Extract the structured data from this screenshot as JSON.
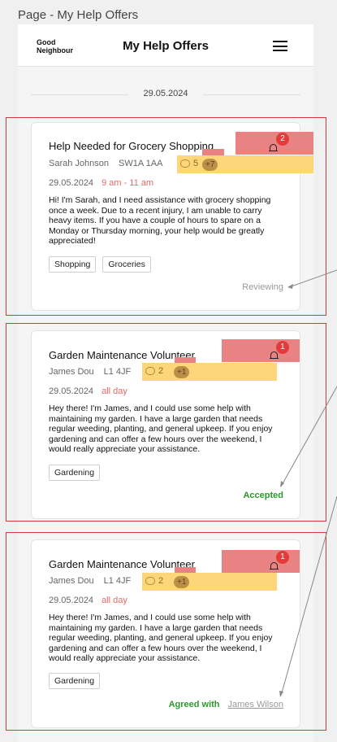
{
  "page_caption": "Page - My Help Offers",
  "topbar": {
    "logo_line1": "Good",
    "logo_line2": "Neighbour",
    "title": "My Help Offers"
  },
  "date_separator": "29.05.2024",
  "offers": [
    {
      "title": "Help Needed for Grocery Shopping",
      "name": "Sarah Johnson",
      "postcode": "SW1A 1AA",
      "comments": "5",
      "more": "+7",
      "notifications": "2",
      "date": "29.05.2024",
      "time": "9 am - 11 am",
      "description": "Hi! I'm Sarah, and I need assistance with grocery shopping once a week. Due to a recent injury, I am unable to carry heavy items. If you have a couple of hours to spare on a Monday or Thursday morning, your help would be greatly appreciated!",
      "tags": [
        "Shopping",
        "Groceries"
      ],
      "status": "Reviewing"
    },
    {
      "title": "Garden Maintenance Volunteer",
      "name": "James Dou",
      "postcode": "L1 4JF",
      "comments": "2",
      "more": "+1",
      "notifications": "1",
      "date": "29.05.2024",
      "time": "all day",
      "description": "Hey there! I'm James, and I could use some help with maintaining my garden. I have a large garden that needs regular weeding, planting, and general upkeep. If you enjoy gardening and can offer a few hours over the weekend, I would really appreciate your assistance.",
      "tags": [
        "Gardening"
      ],
      "status": "Accepted"
    },
    {
      "title": "Garden Maintenance Volunteer",
      "name": "James Dou",
      "postcode": "L1 4JF",
      "comments": "2",
      "more": "+1",
      "notifications": "1",
      "date": "29.05.2024",
      "time": "all day",
      "description": "Hey there! I'm James, and I could use some help with maintaining my garden. I have a large garden that needs regular weeding, planting, and general upkeep. If you enjoy gardening and can offer a few hours over the weekend, I would really appreciate your assistance.",
      "tags": [
        "Gardening"
      ],
      "status_prefix": "Agreed with",
      "status_person": "James Wilson"
    }
  ]
}
